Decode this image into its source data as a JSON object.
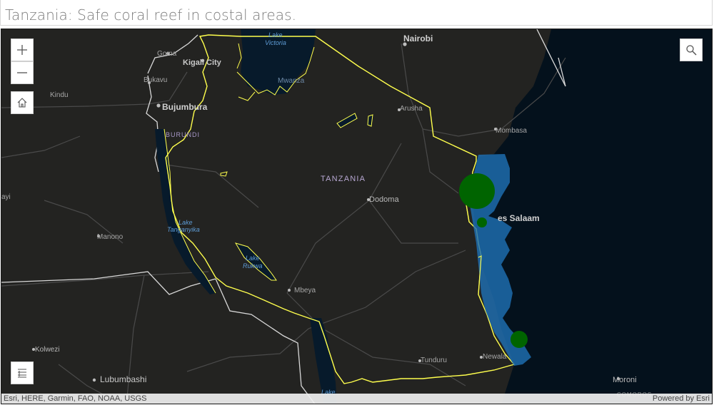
{
  "title": "Tanzania: Safe coral reef in costal areas.",
  "colors": {
    "basemap": "#232321",
    "ocean": "#04111c",
    "lake": "#071a2b",
    "border": "#ffff4d",
    "reef_zone": "#1f6fb2",
    "reef_point": "#006400"
  },
  "map": {
    "country_label": "TANZANIA",
    "neighbor_label": "BURUNDI",
    "water_labels": {
      "victoria": [
        "Lake",
        "Victoria"
      ],
      "tanganyika": [
        "Lake",
        "Tanganyika"
      ],
      "rukwa": [
        "Lake",
        "Rukwa"
      ],
      "mwanza": "Mwanza",
      "malawi": "Lake"
    },
    "cities": {
      "goma": "Goma",
      "kigali": "Kigali City",
      "bukavu": "Bukavu",
      "kindu": "Kindu",
      "bujumbura": "Bujumbura",
      "nairobi": "Nairobi",
      "arusha": "Arusha",
      "mombasa": "Mombasa",
      "dodoma": "Dodoma",
      "dar": "es Salaam",
      "manono": "Manono",
      "mbeya": "Mbeya",
      "kolwezi": "Kolwezi",
      "lubumbashi": "Lubumbashi",
      "tunduru": "Tunduru",
      "newala": "Newala",
      "moroni": "Moroni",
      "edge_ayi": "ayi",
      "comoros": "COMOROS"
    },
    "reef_points_relative_size": [
      3,
      1,
      1.5
    ]
  },
  "controls": {
    "zoom_in_icon": "plus-icon",
    "zoom_out_icon": "minus-icon",
    "home_icon": "home-icon",
    "search_icon": "search-icon",
    "legend_icon": "legend-list-icon"
  },
  "attribution": {
    "left": "Esri, HERE, Garmin, FAO, NOAA, USGS",
    "right": "Powered by Esri"
  }
}
